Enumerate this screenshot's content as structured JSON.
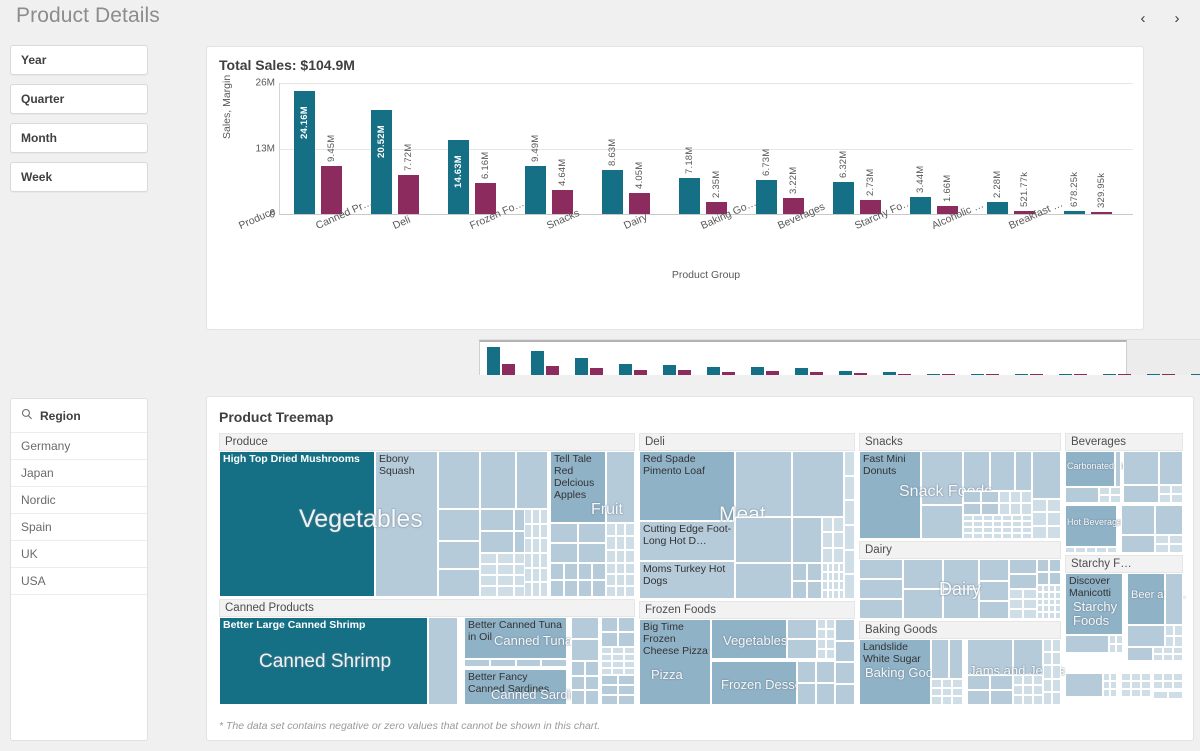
{
  "header": {
    "title": "Product Details",
    "prev_icon": "chevron-left-icon",
    "next_icon": "chevron-right-icon",
    "prev_label": "‹",
    "next_label": "›"
  },
  "filters": {
    "buttons": [
      {
        "label": "Year"
      },
      {
        "label": "Quarter"
      },
      {
        "label": "Month"
      },
      {
        "label": "Week"
      }
    ]
  },
  "region_panel": {
    "search_icon": "search-icon",
    "title": "Region",
    "items": [
      {
        "label": "Germany"
      },
      {
        "label": "Japan"
      },
      {
        "label": "Nordic"
      },
      {
        "label": "Spain"
      },
      {
        "label": "UK"
      },
      {
        "label": "USA"
      }
    ]
  },
  "sales_card": {
    "title": "Total Sales: $104.9M"
  },
  "chart_data": {
    "type": "bar",
    "title": "Total Sales: $104.9M",
    "xlabel": "Product Group",
    "ylabel": "Sales, Margin",
    "ylim": [
      0,
      26000000
    ],
    "yticks": [
      "0",
      "13M",
      "26M"
    ],
    "ytick_values": [
      0,
      13000000,
      26000000
    ],
    "grid": true,
    "legend": "none",
    "categories": [
      "Produce",
      "Canned Pr…",
      "Deli",
      "Frozen Fo…",
      "Snacks",
      "Dairy",
      "Baking Go…",
      "Beverages",
      "Starchy Fo…",
      "Alcoholic …",
      "Breakfast …"
    ],
    "series": [
      {
        "name": "Sales",
        "color": "#157085",
        "values": [
          24160000,
          20520000,
          14630000,
          9490000,
          8630000,
          7180000,
          6730000,
          6320000,
          3440000,
          2280000,
          678250
        ],
        "labels": [
          "24.16M",
          "20.52M",
          "14.63M",
          "9.49M",
          "8.63M",
          "7.18M",
          "6.73M",
          "6.32M",
          "3.44M",
          "2.28M",
          "678.25k"
        ]
      },
      {
        "name": "Margin",
        "color": "#8c2b5d",
        "values": [
          9450000,
          7720000,
          6160000,
          4640000,
          4050000,
          2350000,
          3220000,
          2730000,
          1660000,
          521770,
          329950
        ],
        "labels": [
          "9.45M",
          "7.72M",
          "6.16M",
          "4.64M",
          "4.05M",
          "2.35M",
          "3.22M",
          "2.73M",
          "1.66M",
          "521.77k",
          "329.95k"
        ]
      }
    ]
  },
  "treemap": {
    "title": "Product Treemap",
    "footnote": "* The data set contains negative or zero values that cannot be shown in this chart.",
    "sections": [
      {
        "name": "Produce"
      },
      {
        "name": "Canned Products"
      },
      {
        "name": "Deli"
      },
      {
        "name": "Frozen Foods"
      },
      {
        "name": "Snacks"
      },
      {
        "name": "Dairy"
      },
      {
        "name": "Baking Goods"
      },
      {
        "name": "Beverages"
      },
      {
        "name": "Starchy F…"
      }
    ],
    "tiles": {
      "produce_mushrooms": "High Top Dried Mushrooms",
      "produce_squash": "Ebony Squash",
      "produce_apples": "Tell Tale Red Delcious Apples",
      "canned_shrimp": "Better Large Canned Shrimp",
      "canned_tuna": "Better Canned Tuna in Oil",
      "canned_sardines": "Better Fancy Canned Sardines",
      "deli_pimento": "Red Spade Pimento Loaf",
      "deli_hotdog": "Cutting Edge Foot-Long Hot D…",
      "deli_turkey": "Moms Turkey Hot Dogs",
      "frozen_pizza": "Big Time Frozen Cheese Pizza",
      "snacks_donuts": "Fast Mini Donuts",
      "baking_sugar": "Landslide White Sugar",
      "starchy_manicotti": "Discover Manicotti"
    },
    "group_labels": {
      "vegetables": "Vegetables",
      "fruit": "Fruit",
      "canned_shrimp": "Canned Shrimp",
      "canned_tuna": "Canned Tuna",
      "canned_sardines": "Canned Sardines",
      "meat": "Meat",
      "frozen_vegetables": "Vegetables",
      "frozen_desserts": "Frozen Desserts",
      "pizza": "Pizza",
      "snack_foods": "Snack Foods",
      "dairy": "Dairy",
      "baking_goods": "Baking Goods",
      "jams_jellies": "Jams and Jellies",
      "carbonated_beverages": "Carbonated Beverages",
      "hot_beverages": "Hot Beverages",
      "starchy_foods": "Starchy Foods",
      "beer_and_wine": "Beer and…"
    }
  },
  "colors": {
    "sales": "#157085",
    "margin": "#8c2b5d",
    "tile_dark": "#157085",
    "tile_mid": "#8fb2c7",
    "tile_light": "#b6cbda",
    "tile_pale": "#cfdde7",
    "background": "#f0f0f0"
  }
}
